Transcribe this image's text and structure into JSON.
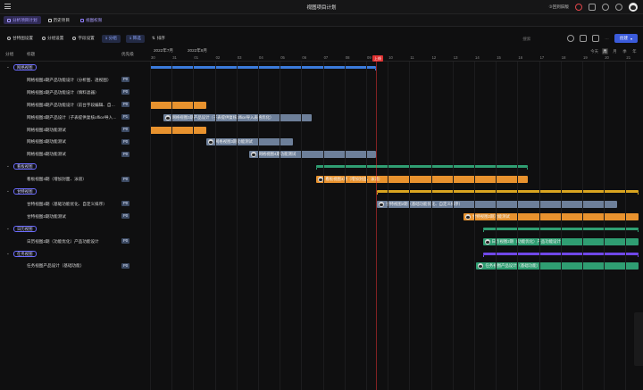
{
  "doc_title": "视图项目计划",
  "header_right": {
    "invite_label": "③回到旧版"
  },
  "view_tabs": [
    {
      "label": "分析项目计划",
      "active": true
    },
    {
      "label": "历史项目",
      "active": false
    },
    {
      "label": "视图权限",
      "active": false
    }
  ],
  "toolbar": {
    "gantt_settings": "甘特图设置",
    "group_settings": "分组设置",
    "field_settings": "字段设置",
    "group_count": "1 分组",
    "filter_count": "1 筛选",
    "sort": "排序",
    "search_placeholder": "搜索",
    "create_label": "创建"
  },
  "zoom": {
    "today": "今天",
    "options": [
      "周",
      "月",
      "季",
      "年"
    ],
    "active": "周"
  },
  "list_header": {
    "group": "分组",
    "title": "标题",
    "priority": "优先级"
  },
  "months": [
    {
      "label": "2022年7月"
    },
    {
      "label": "2022年8月"
    }
  ],
  "days": [
    "30",
    "31",
    "01",
    "02",
    "03",
    "04",
    "05",
    "06",
    "07",
    "08",
    "09",
    "10",
    "11",
    "12",
    "13",
    "14",
    "15",
    "16",
    "17",
    "18",
    "19",
    "20",
    "21",
    "22"
  ],
  "today_label": "上线",
  "colors": {
    "orange": "#e8922e",
    "slate": "#6d7f99",
    "green": "#2f9e72",
    "blue": "#3b7bdb",
    "yellow": "#d9a520",
    "purple": "#7048e8",
    "today": "#e03131"
  },
  "rows": [
    {
      "kind": "group",
      "label": "网格视图",
      "summary_color": "#3b7bdb"
    },
    {
      "kind": "task",
      "title": "网格视图2期产品功能设计（分析图、透视图）",
      "priority": "P0"
    },
    {
      "kind": "task",
      "title": "网格视图2期产品功能设计（填料滤器）",
      "priority": "P0"
    },
    {
      "kind": "task",
      "title": "网格视图3期产品功能设计（前台字段编辑、自…",
      "priority": "P0",
      "bar_color": "#e8922e"
    },
    {
      "kind": "task",
      "title": "网格视图3期产品设计（子表提供复核office导入…",
      "priority": "P1",
      "bar_color": "#6d7f99",
      "bar_label": "网格视图3期产品设计（子表提供复核office导入表格优化）"
    },
    {
      "kind": "task",
      "title": "网格视图3期功能测试",
      "priority": "P0",
      "bar_color": "#e8922e"
    },
    {
      "kind": "task",
      "title": "网格视图3期功能测试",
      "priority": "P0",
      "bar_color": "#6d7f99",
      "bar_label": "网格视图3期功能测试"
    },
    {
      "kind": "task",
      "title": "网格视图4期功能测试",
      "priority": "P0",
      "bar_color": "#6d7f99",
      "bar_label": "网格视图4期功能测试"
    },
    {
      "kind": "group",
      "label": "看板视图",
      "summary_color": "#2f9e72"
    },
    {
      "kind": "task",
      "title": "看板视图3期（增加封面、泳道）",
      "priority": "P0",
      "bar_color": "#e8922e",
      "bar_label": "看板视图3期（增加封面、泳道）"
    },
    {
      "kind": "group",
      "label": "甘特视图",
      "summary_color": "#d9a520"
    },
    {
      "kind": "task",
      "title": "甘特视图2期（基础功能优化、自定义排序）",
      "priority": "P0",
      "bar_color": "#6d7f99",
      "bar_label": "甘特视图2期（基础功能优化、自定义排序）"
    },
    {
      "kind": "task",
      "title": "甘特视图2期功能测试",
      "priority": "P0",
      "bar_color": "#e8922e",
      "bar_label": "甘特视图2期功能测试"
    },
    {
      "kind": "group",
      "label": "日历视图",
      "summary_color": "#2f9e72"
    },
    {
      "kind": "task",
      "title": "日历视图2期（功能优化）产品功能设计",
      "priority": "P0",
      "bar_color": "#2f9e72",
      "bar_label": "日历视图2期（功能优化）产品功能设计"
    },
    {
      "kind": "group",
      "label": "任务视图",
      "summary_color": "#7048e8"
    },
    {
      "kind": "task",
      "title": "任务视图产品设计（基础功能）",
      "priority": "P0",
      "bar_color": "#2f9e72",
      "bar_label": "任务视图产品设计（基础功能）"
    }
  ]
}
